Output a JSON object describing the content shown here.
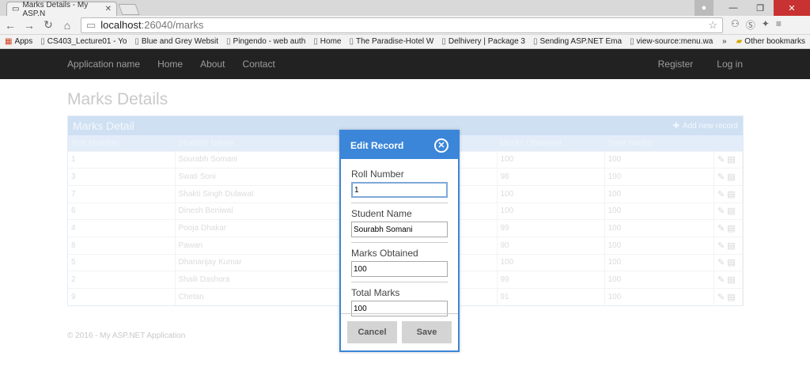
{
  "browser": {
    "tab_title": "Marks Details - My ASP.N",
    "url_host": "localhost",
    "url_path": ":26040/marks",
    "bookmarks": [
      "Apps",
      "CS403_Lecture01 - Yo",
      "Blue and Grey Websit",
      "Pingendo - web auth",
      "Home",
      "The Paradise-Hotel W",
      "Delhivery | Package 3",
      "Sending ASP.NET Ema",
      "view-source:menu.wa"
    ],
    "overflow": "»",
    "other_bookmarks": "Other bookmarks"
  },
  "site": {
    "brand": "Application name",
    "nav": [
      "Home",
      "About",
      "Contact"
    ],
    "right_nav": [
      "Register",
      "Log in"
    ]
  },
  "page": {
    "title": "Marks Details",
    "panel_title": "Marks Detail",
    "add_link": "Add new record",
    "columns": [
      "Roll Number",
      "Student Name",
      "",
      "Marks Obtained",
      "Total Marks"
    ],
    "rows": [
      [
        "1",
        "Sourabh Somani",
        "100",
        "100"
      ],
      [
        "3",
        "Swati Soni",
        "98",
        "100"
      ],
      [
        "7",
        "Shakti Singh Dulawat",
        "100",
        "100"
      ],
      [
        "6",
        "Dinesh Beniwal",
        "100",
        "100"
      ],
      [
        "4",
        "Pooja Dhakar",
        "99",
        "100"
      ],
      [
        "8",
        "Pawan",
        "90",
        "100"
      ],
      [
        "5",
        "Dhananjay Kumar",
        "100",
        "100"
      ],
      [
        "2",
        "Shaili Dashora",
        "99",
        "100"
      ],
      [
        "9",
        "Chetan",
        "91",
        "100"
      ]
    ],
    "footer": "© 2016 - My ASP.NET Application"
  },
  "modal": {
    "title": "Edit Record",
    "close": "✕",
    "fields": [
      {
        "label": "Roll Number",
        "value": "1"
      },
      {
        "label": "Student Name",
        "value": "Sourabh Somani"
      },
      {
        "label": "Marks Obtained",
        "value": "100"
      },
      {
        "label": "Total Marks",
        "value": "100"
      }
    ],
    "cancel": "Cancel",
    "save": "Save"
  }
}
